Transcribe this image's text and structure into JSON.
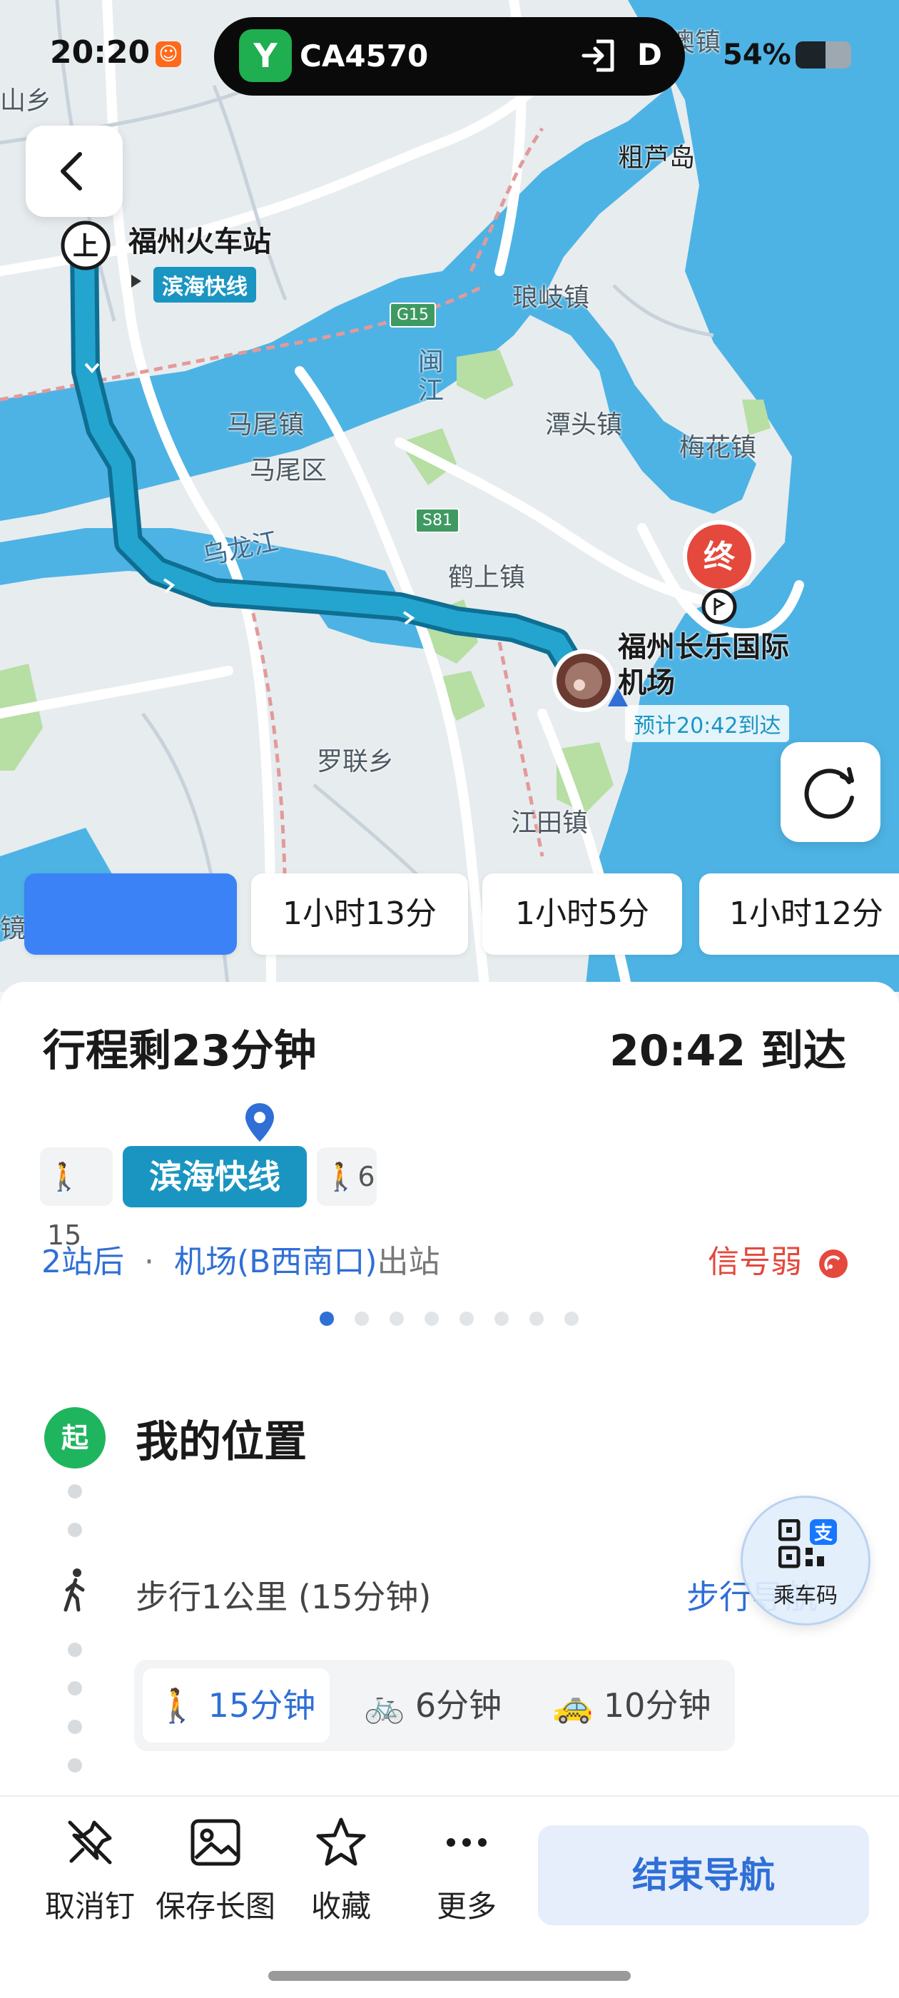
{
  "status_bar": {
    "time": "20:20",
    "battery": "54%",
    "battery_level": 0.54
  },
  "live_activity": {
    "app_icon": "railway-icon",
    "flight": "CA4570",
    "gate": "D"
  },
  "map": {
    "labels": {
      "shanxiang": "山乡",
      "lu_zhen": "澳镇",
      "culudao": "粗芦岛",
      "langqi": "琅岐镇",
      "mawei_town": "马尾镇",
      "mawei_district": "马尾区",
      "tantou": "潭头镇",
      "meihua": "梅花镇",
      "minjiang": "闽江",
      "wulongjiang": "乌龙江",
      "heshang": "鹤上镇",
      "luolian": "罗联乡",
      "jiangtian": "江田镇",
      "jing": "镜"
    },
    "shields": {
      "g15": "G15",
      "s81": "S81"
    },
    "start": {
      "badge": "上",
      "name": "福州火车站",
      "line": "滨海快线"
    },
    "end": {
      "badge": "终",
      "name_line1": "福州长乐国际",
      "name_line2": "机场",
      "eta": "预计20:42到达"
    }
  },
  "route_options": [
    "",
    "1小时13分",
    "1小时5分",
    "1小时12分"
  ],
  "summary": {
    "remaining": "行程剩23分钟",
    "arrival": "20:42 到达",
    "walk_before": "15",
    "line": "滨海快线",
    "walk_after": "6",
    "stops": "2站后",
    "separator": "·",
    "exit_station": "机场(B西南口)",
    "exit_suffix": "出站",
    "signal": "信号弱",
    "page_count": 8,
    "page_active": 0
  },
  "detail": {
    "start_badge": "起",
    "start_label": "我的位置",
    "walk_text": "步行1公里 (15分钟)",
    "walk_nav": "步行导航",
    "qr_label": "乘车码",
    "modes": [
      {
        "icon": "walk-icon",
        "label": "15分钟"
      },
      {
        "icon": "bike-icon",
        "label": "6分钟"
      },
      {
        "icon": "taxi-icon",
        "label": "10分钟"
      }
    ]
  },
  "toolbar": {
    "unpin": "取消钉",
    "save_image": "保存长图",
    "favorite": "收藏",
    "more": "更多",
    "end_navigation": "结束导航"
  },
  "colors": {
    "route": "#1a95c2",
    "accent_blue": "#2f6fd6",
    "tab_active": "#3b82f6",
    "start_green": "#1fb55e",
    "end_red": "#e5483d",
    "water": "#4db3e4"
  }
}
